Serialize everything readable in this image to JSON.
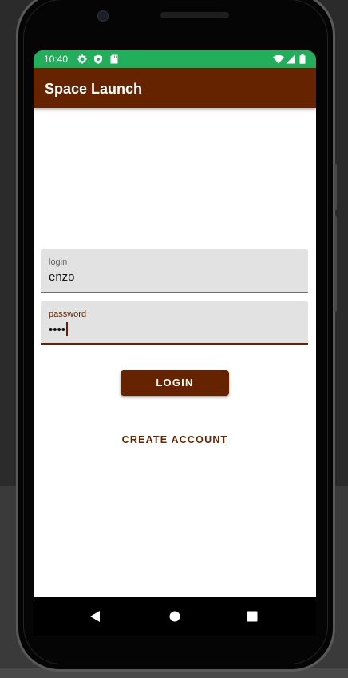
{
  "status_bar": {
    "time": "10:40",
    "background": "#23ae5c",
    "left_icons": [
      "gear-icon",
      "shield-icon",
      "sd-card-icon"
    ],
    "right_icons": [
      "wifi-icon",
      "signal-icon",
      "battery-icon"
    ]
  },
  "app_bar": {
    "title": "Space Launch",
    "background": "#652300"
  },
  "form": {
    "login": {
      "label": "login",
      "value": "enzo"
    },
    "password": {
      "label": "password",
      "masked_value": "••••"
    },
    "login_button": "LOGIN",
    "create_account_button": "CREATE ACCOUNT"
  },
  "navigation": {
    "buttons": [
      "back-icon",
      "home-icon",
      "recents-icon"
    ]
  },
  "colors": {
    "primary": "#652300",
    "status": "#23ae5c",
    "field_bg": "#e2e2e2"
  }
}
